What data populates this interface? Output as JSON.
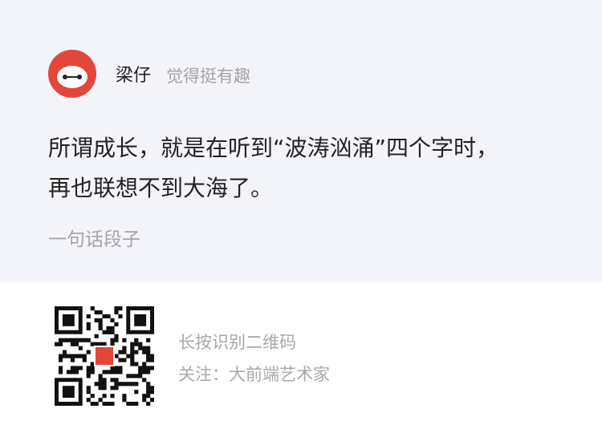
{
  "post": {
    "author": "梁仔",
    "author_note": "觉得挺有趣",
    "quote_line1": "所谓成长，就是在听到“波涛汹涌”四个字时，",
    "quote_line2": "再也联想不到大海了。",
    "source": "一句话段子",
    "avatar_icon": "baymax-avatar-icon"
  },
  "footer": {
    "qr_icon": "qr-code-icon",
    "hint": "长按识别二维码",
    "follow": "关注：大前端艺术家"
  },
  "colors": {
    "card_bg": "#f4f5fb",
    "avatar_bg": "#e2473a",
    "muted_text": "#a3a3a8"
  }
}
